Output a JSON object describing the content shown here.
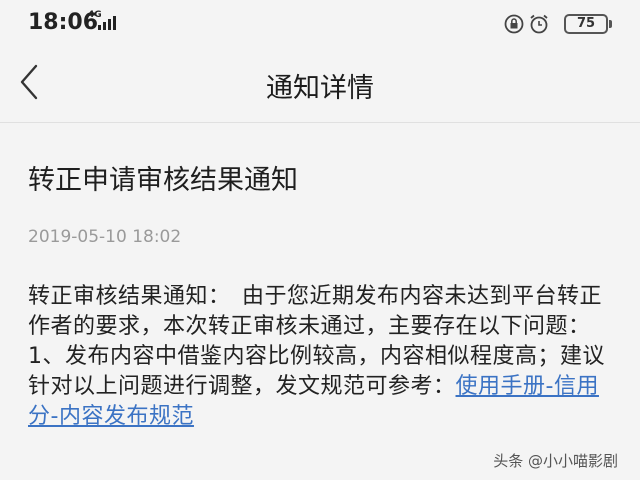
{
  "status_bar": {
    "time": "18:06",
    "network": "4G",
    "battery": "75"
  },
  "header": {
    "title": "通知详情"
  },
  "notice": {
    "title": "转正申请审核结果通知",
    "time": "2019-05-10 18:02",
    "body": "转正审核结果通知：　由于您近期发布内容未达到平台转正作者的要求，本次转正审核未通过，主要存在以下问题：　1、发布内容中借鉴内容比例较高，内容相似程度高；建议针对以上问题进行调整，发文规范可参考：",
    "link_text": "使用手册-信用分-内容发布规范"
  },
  "watermark": "头条 @小小喵影剧",
  "colors": {
    "link": "#3b73c4",
    "background": "#f4f4f4",
    "meta_text": "#9a9a9a"
  }
}
